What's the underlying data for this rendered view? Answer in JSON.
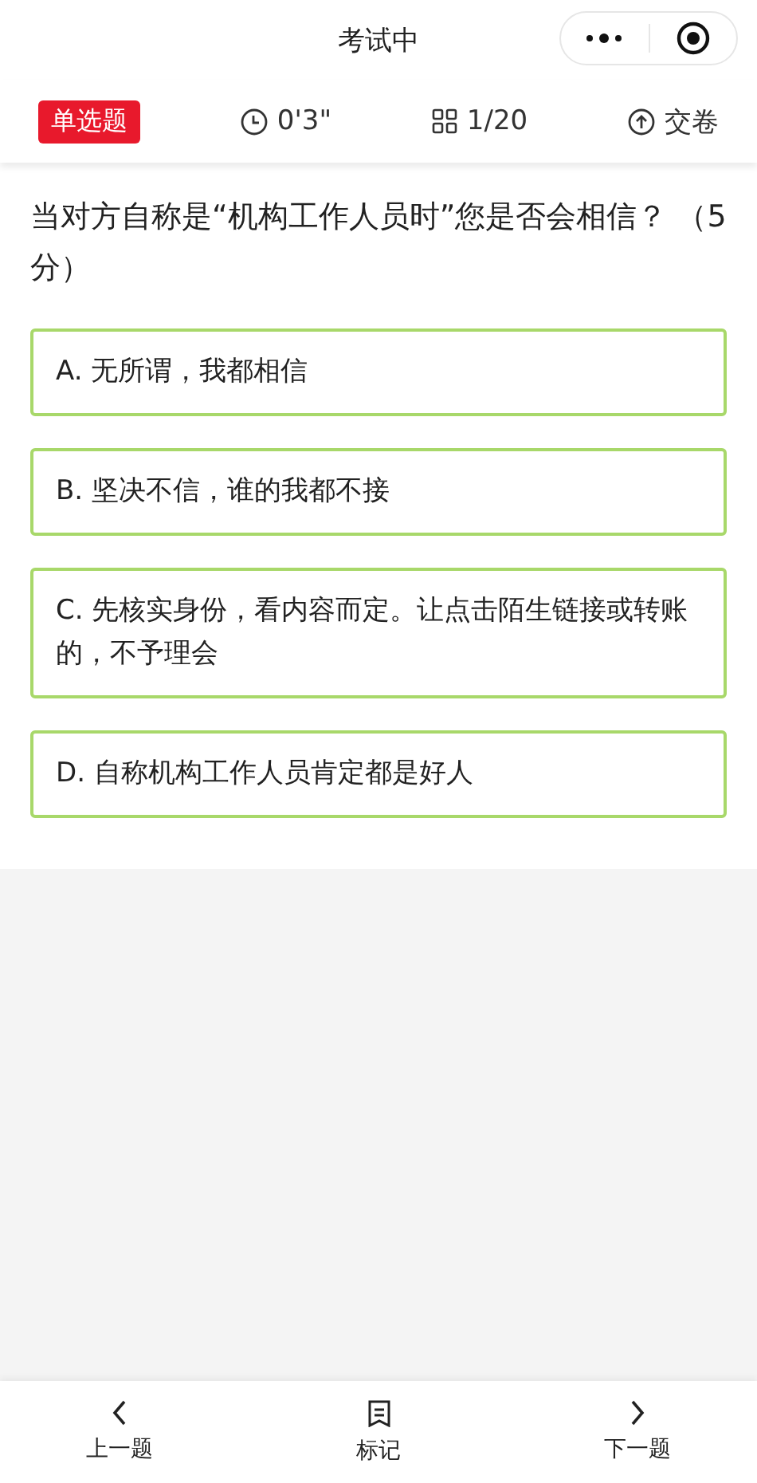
{
  "window": {
    "title": "考试中"
  },
  "toolbar": {
    "type_badge": "单选题",
    "timer": "0'3\"",
    "progress": "1/20",
    "submit": "交卷"
  },
  "question": {
    "text": "当对方自称是“机构工作人员时”您是否会相信？ （5分）"
  },
  "options": [
    {
      "text": "A. 无所谓，我都相信",
      "selected": false
    },
    {
      "text": "B. 坚决不信，谁的我都不接",
      "selected": false
    },
    {
      "text": "C. 先核实身份，看内容而定。让点击陌生链接或转账的，不予理会",
      "selected": false
    },
    {
      "text": "D. 自称机构工作人员肯定都是好人",
      "selected": false
    }
  ],
  "bottom_bar": [
    {
      "kind": "prev",
      "label": "上一题"
    },
    {
      "kind": "mark",
      "label": "标记"
    },
    {
      "kind": "next",
      "label": "下一题"
    }
  ]
}
